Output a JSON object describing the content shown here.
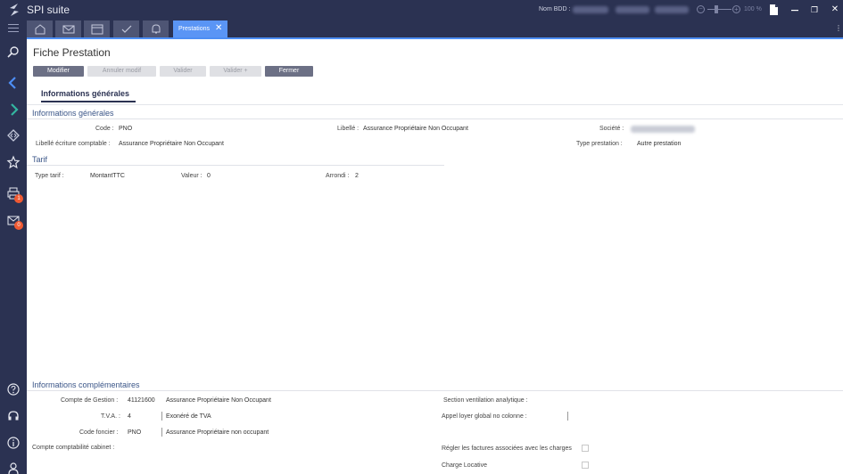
{
  "app": {
    "name": "SPI suite",
    "db_label": "Nom BDD :",
    "zoom_minus": "−",
    "zoom_plus": "+",
    "zoom": "100 %"
  },
  "window": {
    "restore": "❐",
    "close": "✕",
    "more": "⋮"
  },
  "tabs": {
    "icons": [
      "home-icon",
      "mail-icon",
      "calendar-icon",
      "check-icon",
      "bell-icon"
    ],
    "active": {
      "label": "Prestations",
      "close": "✕"
    }
  },
  "sidebar": {
    "items": [
      "search-icon",
      "diamond-left-icon",
      "diamond-right-icon",
      "diamond-code-icon",
      "star-icon",
      "print-icon",
      "envelope-icon",
      "help-icon",
      "headset-icon",
      "info-icon",
      "user-icon"
    ],
    "badges": {
      "print": "1",
      "envelope": "0"
    }
  },
  "page": {
    "title": "Fiche Prestation",
    "buttons": {
      "modifier": "Modifier",
      "annuler": "Annuler modif",
      "valider": "Valider",
      "valider_plus": "Valider +",
      "fermer": "Fermer"
    },
    "tab": "Informations générales"
  },
  "general": {
    "title": "Informations générales",
    "code_label": "Code :",
    "code": "PNO",
    "libelle_label": "Libellé :",
    "libelle": "Assurance Propriétaire Non Occupant",
    "societe_label": "Société :",
    "libelle_ecriture_label": "Libellé écriture comptable :",
    "libelle_ecriture": "Assurance Propriétaire Non Occupant",
    "type_prestation_label": "Type prestation :",
    "type_prestation": "Autre prestation"
  },
  "tarif": {
    "title": "Tarif",
    "type_label": "Type tarif :",
    "type": "MontantTTC",
    "valeur_label": "Valeur :",
    "valeur": "0",
    "arrondi_label": "Arrondi :",
    "arrondi": "2"
  },
  "complementaires": {
    "title": "Informations complémentaires",
    "compte_gestion_label": "Compte de Gestion :",
    "compte_gestion_code": "41121600",
    "compte_gestion": "Assurance Propriétaire Non Occupant",
    "tva_label": "T.V.A. :",
    "tva_code": "4",
    "tva": "Exonéré de TVA",
    "code_foncier_label": "Code foncier :",
    "code_foncier_code": "PNO",
    "code_foncier": "Assurance Propriétaire non occupant",
    "compte_cabinet_label": "Compte comptabilité cabinet :",
    "section_label": "Section ventilation analytique :",
    "appel_loyer_label": "Appel loyer global no colonne :",
    "regler_label": "Régler les factures associées avec les charges",
    "charge_locative_label": "Charge Locative"
  },
  "colors": {
    "sidebar": "#2b3252",
    "accent": "#5a95f5",
    "badge": "#f05a33",
    "section": "#3b5688"
  }
}
